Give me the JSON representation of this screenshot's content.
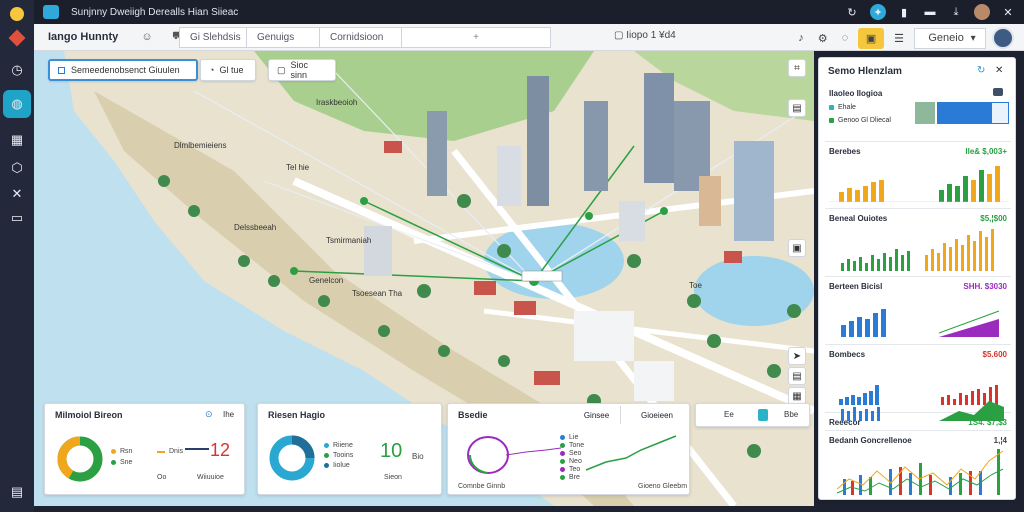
{
  "app": {
    "title": "Sunjnny Dweiigh   Derealls Hian Siieac"
  },
  "toolbar": {
    "name": "Iango  Hunnty",
    "seg1": "Gi Slehdsis",
    "seg2": "Genuigs",
    "seg3": "Cornidsioon",
    "seg4_icon": "+",
    "zoom": "Iiopo  1 ¥d4",
    "button": "Geneio"
  },
  "chips": {
    "chip1": "Semeedenobsenct Giuulen",
    "chip2": "Gl tue",
    "chip3": "Sioc sinn"
  },
  "map_labels": [
    "Iraskbeoioh",
    "Dlmlbemieiens",
    "Tel hie",
    "Delssbeeah",
    "Tsmirmaniah",
    "Genelcon",
    "Tsoesean  Tha",
    "Toe"
  ],
  "cards": {
    "c1": {
      "title": "Milmoiol Bireon",
      "btn": "Ihe",
      "legend": [
        "Rsn",
        "Sne",
        "Dnis"
      ],
      "big": "12",
      "foot": [
        "Oo",
        "Wiiuuioe"
      ]
    },
    "c2": {
      "title": "Riesen Hagio",
      "legend": [
        "Riiene",
        "Tooins",
        "Iiolue"
      ],
      "big": "10",
      "small": "Bio",
      "foot": [
        "Sieon"
      ]
    },
    "c3": {
      "title": "Bsedie",
      "tab1": "Ginsee",
      "tab2": "Gioeieen",
      "legend": [
        "Lie",
        "Tone",
        "Seo",
        "Neo",
        "Teo",
        "Bre"
      ],
      "foot": "Comnbe Ginnb",
      "foot2": "Gioeno  Gleebm"
    },
    "c4": {
      "title": "Ee",
      "btn": "Bbe"
    }
  },
  "panel": {
    "title": "Semo Hlenzlam",
    "sub_title": "Ilaoleo Ilogioa",
    "sub_items": [
      "Ehale",
      "Genoo Gl Dliecal"
    ],
    "rows": [
      {
        "label": "Berebes",
        "value": "Ile&  $,003+"
      },
      {
        "label": "Beneal  Ouiotes",
        "value": "$5,¦$00"
      },
      {
        "label": "Berteen Bicisl",
        "value": "SHH.  $3030"
      },
      {
        "label": "Bombecs",
        "value": "$5.600"
      },
      {
        "label": "Reeecor",
        "value": "1S4.  $7,$3"
      },
      {
        "label": "Bedanh Goncrellenoe",
        "value": "1,¦4"
      }
    ],
    "row_colors": [
      "#2aa043",
      "#2aa043",
      "#9b2bbf",
      "#d9342b",
      "#2aa043",
      "#2a7bd6"
    ]
  },
  "colors": {
    "accent": "#1fa3c7",
    "yellow": "#f6c73c",
    "green": "#2aa043",
    "purple": "#9b2bbf",
    "red": "#d9342b",
    "blue": "#2a7bd6"
  }
}
